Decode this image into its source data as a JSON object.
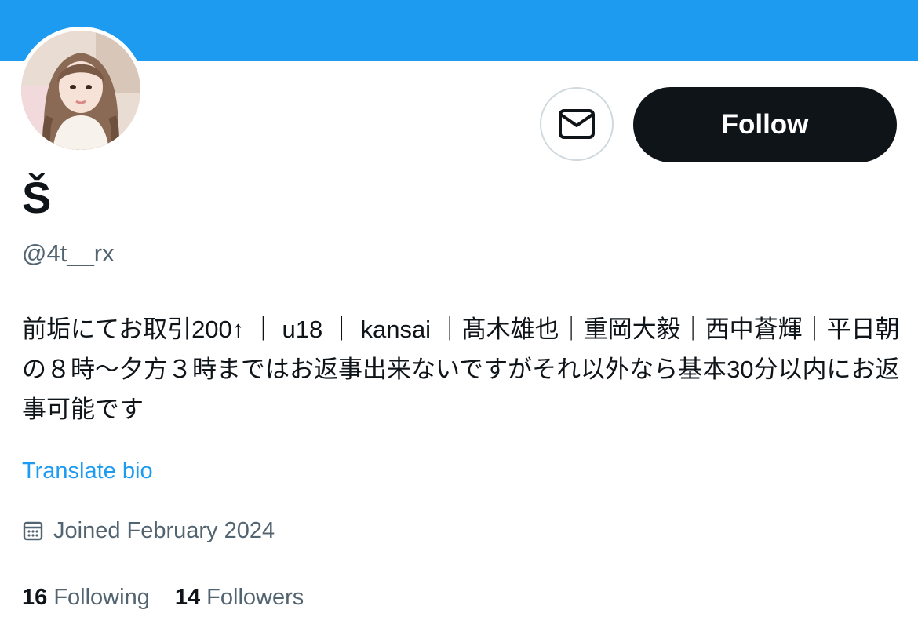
{
  "profile": {
    "display_name": "Š",
    "handle": "@4t__rx",
    "bio": "前垢にてお取引200↑ ｜ u18 ｜ kansai ｜髙木雄也｜重岡大毅｜西中蒼輝｜平日朝の８時〜夕方３時まではお返事出来ないですがそれ以外なら基本30分以内にお返事可能です",
    "translate_label": "Translate bio",
    "joined": "Joined February 2024",
    "following_count": "16",
    "following_label": "Following",
    "followers_count": "14",
    "followers_label": "Followers"
  },
  "actions": {
    "follow_label": "Follow",
    "message_icon": "envelope-icon"
  },
  "icons": {
    "calendar": "calendar-icon"
  },
  "colors": {
    "banner": "#1d9bf0",
    "link": "#1d9bf0",
    "primary_button": "#0f1419",
    "secondary_text": "#536471"
  }
}
